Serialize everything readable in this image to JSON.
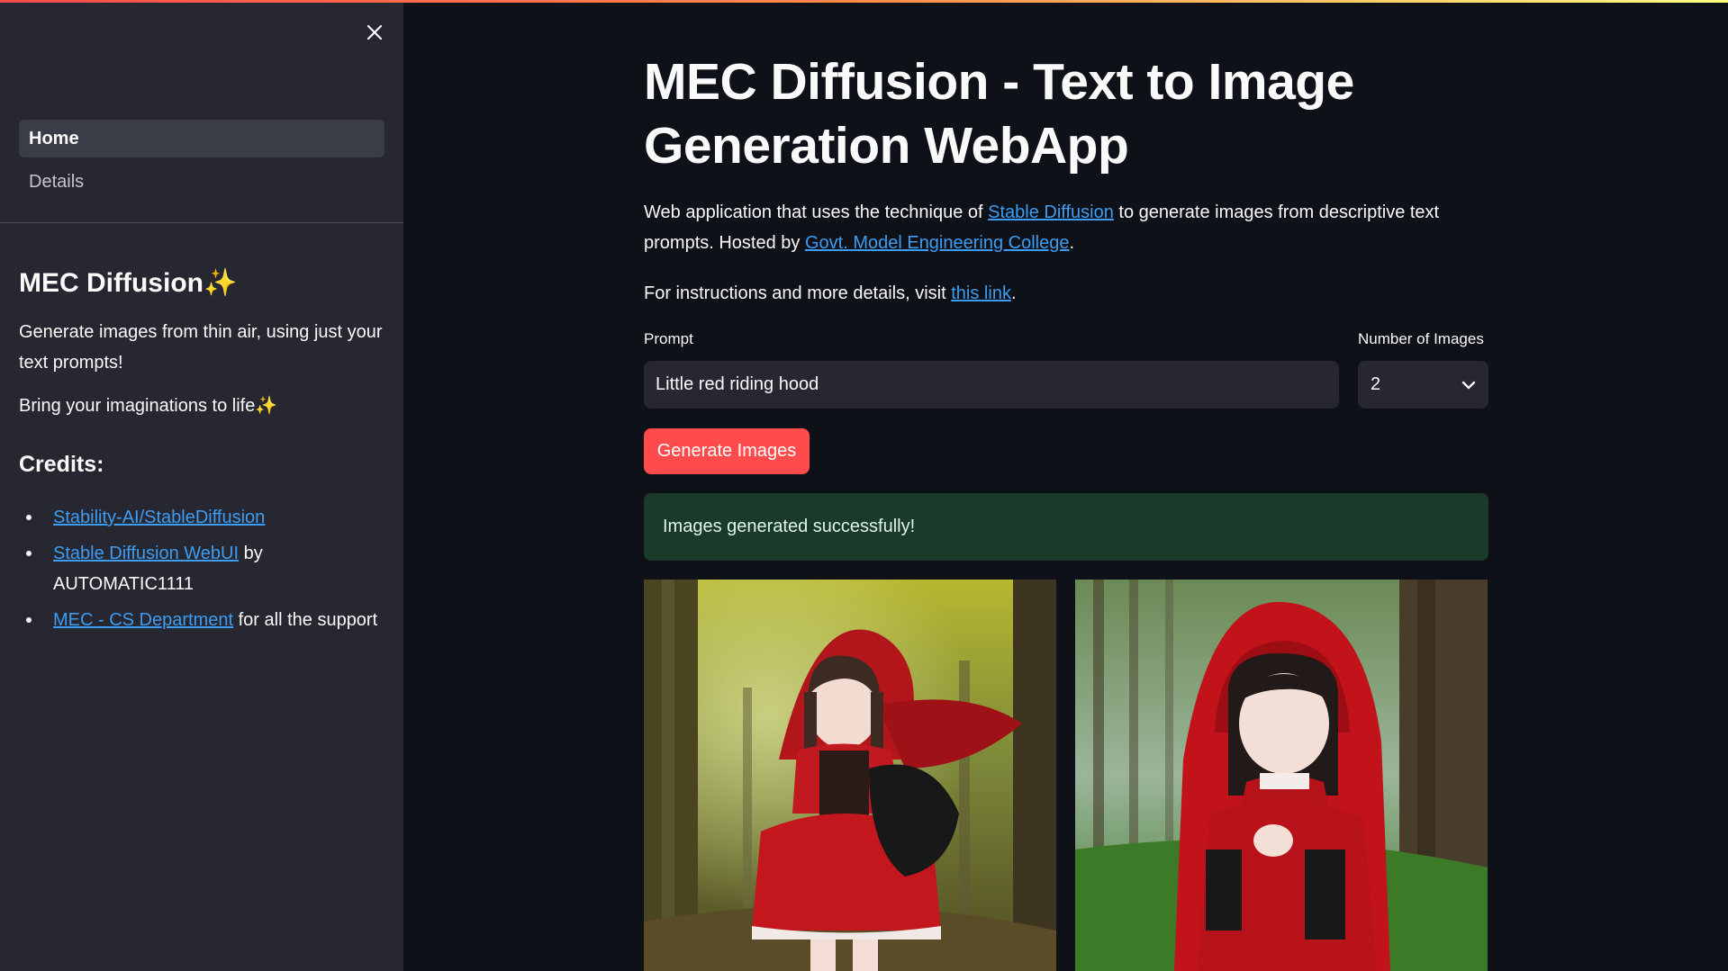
{
  "sidebar": {
    "nav": [
      {
        "label": "Home",
        "active": true
      },
      {
        "label": "Details",
        "active": false
      }
    ],
    "title": "MEC Diffusion✨",
    "tagline": "Generate images from thin air, using just your text prompts!",
    "tagline2": "Bring your imaginations to life✨",
    "credits_heading": "Credits:",
    "credits": [
      {
        "link": "Stability-AI/StableDiffusion",
        "suffix": ""
      },
      {
        "link": "Stable Diffusion WebUI",
        "suffix": " by AUTOMATIC1111"
      },
      {
        "link": "MEC - CS Department",
        "suffix": " for all the support"
      }
    ]
  },
  "main": {
    "title": "MEC Diffusion - Text to Image Generation WebApp",
    "desc_pre": "Web application that uses the technique of ",
    "desc_link1": "Stable Diffusion",
    "desc_mid": " to generate images from descriptive text prompts. Hosted by ",
    "desc_link2": "Govt. Model Engineering College",
    "desc_post": ".",
    "instr_pre": "For instructions and more details, visit ",
    "instr_link": "this link",
    "instr_post": ".",
    "prompt_label": "Prompt",
    "prompt_value": "Little red riding hood",
    "count_label": "Number of Images",
    "count_value": "2",
    "button_label": "Generate Images",
    "success_message": "Images generated successfully!"
  },
  "colors": {
    "accent": "#ff4b4b",
    "link": "#3d9df3",
    "background": "#0e1117",
    "sidebar": "#262730",
    "success_bg": "#1a3a2a"
  },
  "icons": {
    "close": "close-icon",
    "dropdown": "chevron-down-icon"
  }
}
